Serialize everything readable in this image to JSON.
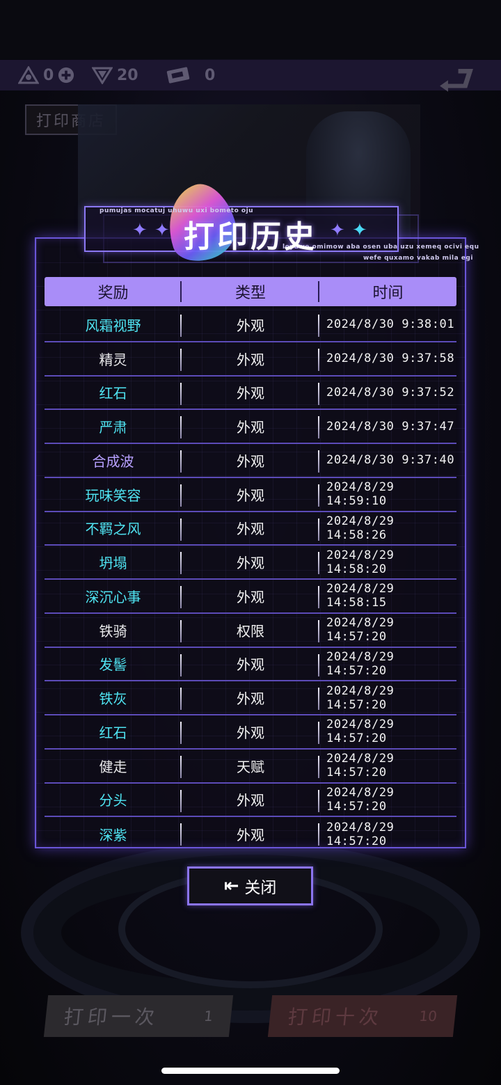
{
  "colors": {
    "accent": "#a98df8",
    "reward_cyan": "#4fe3f1",
    "reward_purple": "#b7a0ff",
    "reward_white": "#e8e8ea",
    "row_border": "#5c4bb8"
  },
  "background": {
    "resources": [
      {
        "icon": "triangle-crest-icon",
        "value": "0"
      },
      {
        "icon": "diamond-crest-icon",
        "value": "20"
      },
      {
        "icon": "ticket-icon",
        "value": "0"
      }
    ],
    "shop_tag": "打印商店",
    "print_once": {
      "label": "打印一次",
      "cost": "1"
    },
    "print_ten": {
      "label": "打印十次",
      "cost": "10"
    }
  },
  "modal": {
    "title": "打印历史",
    "title_deco_top": "pumujas mocatuj uhuwu uxi bometo oju",
    "title_deco_right": "loyuwe omimow aba osen uba uzu xemeq ocivi equ",
    "title_deco_right2": "wefe quxamo vakab mila egi",
    "headers": {
      "reward": "奖励",
      "type": "类型",
      "time": "时间"
    },
    "rows": [
      {
        "reward": "风霜视野",
        "type": "外观",
        "time": "2024/8/30 9:38:01",
        "color": "#4fe3f1"
      },
      {
        "reward": "精灵",
        "type": "外观",
        "time": "2024/8/30 9:37:58",
        "color": "#e8e8ea"
      },
      {
        "reward": "红石",
        "type": "外观",
        "time": "2024/8/30 9:37:52",
        "color": "#4fe3f1"
      },
      {
        "reward": "严肃",
        "type": "外观",
        "time": "2024/8/30 9:37:47",
        "color": "#4fe3f1"
      },
      {
        "reward": "合成波",
        "type": "外观",
        "time": "2024/8/30 9:37:40",
        "color": "#b7a0ff"
      },
      {
        "reward": "玩味笑容",
        "type": "外观",
        "time": "2024/8/29 14:59:10",
        "color": "#4fe3f1"
      },
      {
        "reward": "不羁之风",
        "type": "外观",
        "time": "2024/8/29 14:58:26",
        "color": "#4fe3f1"
      },
      {
        "reward": "坍塌",
        "type": "外观",
        "time": "2024/8/29 14:58:20",
        "color": "#4fe3f1"
      },
      {
        "reward": "深沉心事",
        "type": "外观",
        "time": "2024/8/29 14:58:15",
        "color": "#4fe3f1"
      },
      {
        "reward": "铁骑",
        "type": "权限",
        "time": "2024/8/29 14:57:20",
        "color": "#e8e8ea"
      },
      {
        "reward": "发髻",
        "type": "外观",
        "time": "2024/8/29 14:57:20",
        "color": "#4fe3f1"
      },
      {
        "reward": "铁灰",
        "type": "外观",
        "time": "2024/8/29 14:57:20",
        "color": "#4fe3f1"
      },
      {
        "reward": "红石",
        "type": "外观",
        "time": "2024/8/29 14:57:20",
        "color": "#4fe3f1"
      },
      {
        "reward": "健走",
        "type": "天赋",
        "time": "2024/8/29 14:57:20",
        "color": "#e8e8ea"
      },
      {
        "reward": "分头",
        "type": "外观",
        "time": "2024/8/29 14:57:20",
        "color": "#4fe3f1"
      },
      {
        "reward": "深紫",
        "type": "外观",
        "time": "2024/8/29 14:57:20",
        "color": "#4fe3f1"
      }
    ],
    "close_label": "关闭",
    "close_icon": "exit-arrow-icon"
  }
}
